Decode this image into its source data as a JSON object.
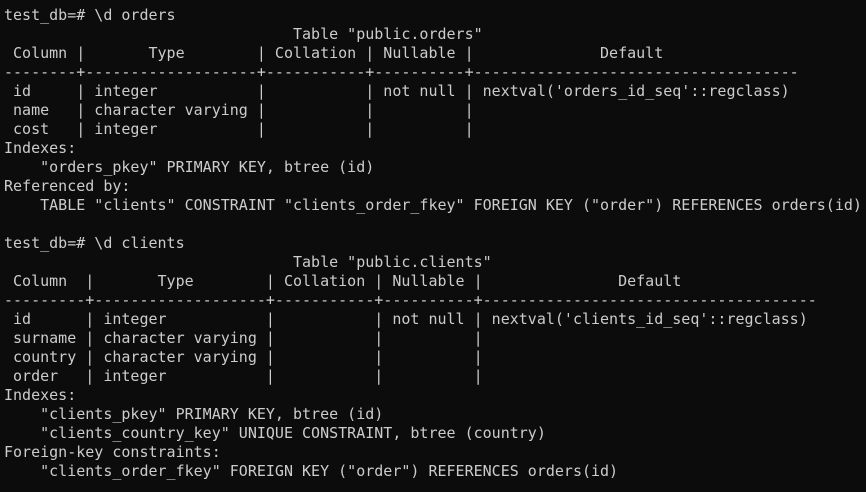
{
  "terminal": {
    "lines": [
      "test_db=# \\d orders",
      "                                Table \"public.orders\"",
      " Column |       Type        | Collation | Nullable |              Default",
      "--------+-------------------+-----------+----------+------------------------------------",
      " id     | integer           |           | not null | nextval('orders_id_seq'::regclass)",
      " name   | character varying |           |          |",
      " cost   | integer           |           |          |",
      "Indexes:",
      "    \"orders_pkey\" PRIMARY KEY, btree (id)",
      "Referenced by:",
      "    TABLE \"clients\" CONSTRAINT \"clients_order_fkey\" FOREIGN KEY (\"order\") REFERENCES orders(id)",
      "",
      "test_db=# \\d clients",
      "                                Table \"public.clients\"",
      " Column  |       Type        | Collation | Nullable |               Default",
      "---------+-------------------+-----------+----------+-------------------------------------",
      " id      | integer           |           | not null | nextval('clients_id_seq'::regclass)",
      " surname | character varying |           |          |",
      " country | character varying |           |          |",
      " order   | integer           |           |          |",
      "Indexes:",
      "    \"clients_pkey\" PRIMARY KEY, btree (id)",
      "    \"clients_country_key\" UNIQUE CONSTRAINT, btree (country)",
      "Foreign-key constraints:",
      "    \"clients_order_fkey\" FOREIGN KEY (\"order\") REFERENCES orders(id)"
    ]
  },
  "colors": {
    "background": "#0c0c0c",
    "foreground": "#cccccc"
  }
}
